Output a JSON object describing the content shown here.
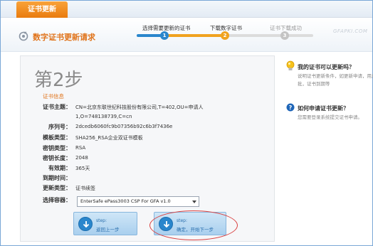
{
  "tab": {
    "label": "证书更新"
  },
  "header": {
    "title": "数字证书更新请求",
    "watermark": "GFAPKI.COM"
  },
  "steps": [
    {
      "label": "选择需要更新的证书",
      "number": "1",
      "state": "done"
    },
    {
      "label": "下载数字证书",
      "number": "2",
      "state": "current"
    },
    {
      "label": "证书下载成功",
      "number": "3",
      "state": "pending"
    }
  ],
  "main": {
    "step_heading": "第2步",
    "section_title": "证书信息",
    "fields": [
      {
        "label": "证书主题：",
        "value": "CN=北京东联世纪科技股份有限公司,T=402,OU=申请人",
        "value2": "1,O=748138739,C=cn"
      },
      {
        "label": "序列号：",
        "value": "2dcedb6060fc9b07356b92c6b3f7436e"
      },
      {
        "label": "模板类型：",
        "value": "SHA256_RSA企业双证书模板"
      },
      {
        "label": "密钥类型：",
        "value": "RSA"
      },
      {
        "label": "密钥长度：",
        "value": "2048"
      },
      {
        "label": "有效期：",
        "value": "365天"
      },
      {
        "label": "到期时间：",
        "value": ""
      },
      {
        "label": "更新类型：",
        "value": "证书续签"
      },
      {
        "label": "选择容器：",
        "value": ""
      }
    ],
    "container_select": {
      "selected": "EnterSafe ePass3003 CSP For GFA v1.0"
    },
    "buttons": {
      "prev": {
        "step": "step:",
        "text": "返回上一步"
      },
      "next": {
        "step": "step:",
        "text": "确定，开始下一步"
      }
    }
  },
  "help": [
    {
      "question": "我的证书可以更新吗？",
      "answer_lines": [
        "说明证书更新条件，如更新申请，用户必须在",
        "批，证书到期等"
      ]
    },
    {
      "question": "如何申请证书更新？",
      "answer_lines": [
        "您需要登录系统提交证书申请。"
      ]
    }
  ],
  "colors": {
    "accent": "#e0731a",
    "primary": "#2a86cc",
    "current": "#f0a21f"
  }
}
